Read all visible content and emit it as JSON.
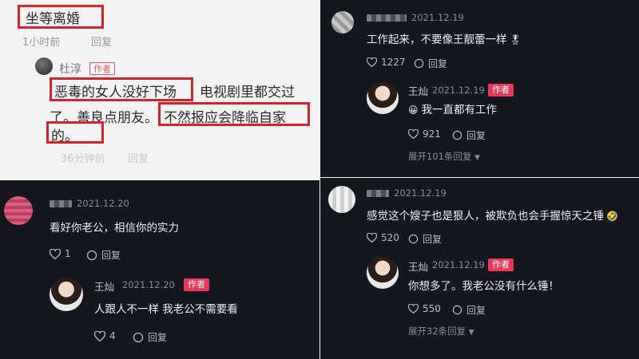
{
  "top_left": {
    "line1": "坐等离婚",
    "line1_meta": "1小时前",
    "line1_reply": "回复",
    "author_name": "杜淳",
    "author_tag": "作者",
    "reply_part1": "恶毒的女人没好下场",
    "reply_part2": "电视剧里都交过",
    "reply_part3": "了。善良点朋友。",
    "reply_part4": "不然报应会降临自家",
    "reply_part5": "的。",
    "reply_meta": "36分钟前",
    "reply_reply": "回复"
  },
  "top_right": {
    "date": "2021.12.19",
    "comment": "工作起来，不要像王靓蕾一样",
    "emoji": "🎖",
    "likes": "1227",
    "reply_label": "回复",
    "reply": {
      "name": "王灿",
      "date": "2021.12.19",
      "tag": "作者",
      "emoji": "😀",
      "text": "我一直都有工作",
      "likes": "921",
      "reply_label": "回复"
    },
    "expand": "展开101条回复"
  },
  "bottom_left": {
    "date": "2021.12.20",
    "comment": "看好你老公，相信你的实力",
    "likes": "1",
    "reply_label": "回复",
    "reply": {
      "name": "王灿",
      "date": "2021.12.20",
      "tag": "作者",
      "text": "人跟人不一样 我老公不需要看",
      "likes": "4",
      "reply_label": "回复"
    }
  },
  "bottom_right": {
    "date": "2021.12.19",
    "comment": "感觉这个嫂子也是狠人，被欺负也会手握惊天之锤",
    "emoji": "🤣",
    "likes": "520",
    "reply_label": "回复",
    "reply": {
      "name": "王灿",
      "date": "2021.12.19",
      "tag": "作者",
      "text": "你想多了。我老公没有什么锤！",
      "likes": "550",
      "reply_label": "回复"
    },
    "expand": "展开32条回复"
  },
  "colors": {
    "dark_bg": "#16161f",
    "author_tag": "#e8375a",
    "highlight_box": "#d2242a"
  }
}
